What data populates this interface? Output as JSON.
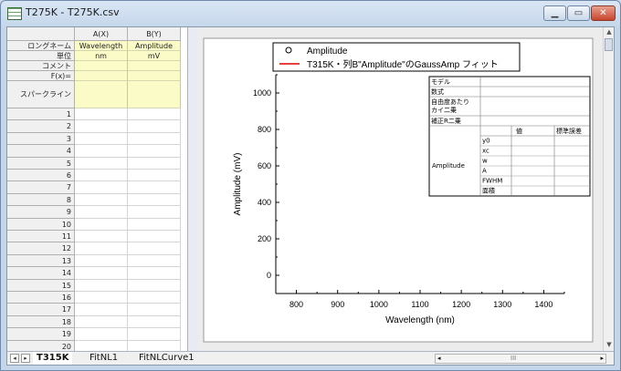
{
  "window": {
    "title": "T275K - T275K.csv",
    "min_label": "▁",
    "max_label": "▭",
    "close_label": "✕"
  },
  "sheet": {
    "columns": [
      "A(X)",
      "B(Y)"
    ],
    "label_rows": [
      {
        "label": "ロングネーム",
        "values": [
          "Wavelength",
          "Amplitude"
        ]
      },
      {
        "label": "単位",
        "values": [
          "nm",
          "mV"
        ]
      },
      {
        "label": "コメント",
        "values": [
          "",
          ""
        ]
      },
      {
        "label": "F(x)=",
        "values": [
          "",
          ""
        ]
      },
      {
        "label": "スパークライン",
        "values": [
          "",
          ""
        ]
      }
    ],
    "rows": [
      "1",
      "2",
      "3",
      "4",
      "5",
      "6",
      "7",
      "8",
      "9",
      "10",
      "11",
      "12",
      "13",
      "14",
      "15",
      "16",
      "17",
      "18",
      "19",
      "20"
    ]
  },
  "tabs": [
    {
      "label": "T315K",
      "active": true
    },
    {
      "label": "FitNL1",
      "active": false
    },
    {
      "label": "FitNLCurve1",
      "active": false
    }
  ],
  "legend": {
    "items": [
      {
        "symbol": "circle",
        "label": "Amplitude"
      },
      {
        "symbol": "red-line",
        "label": "T315K・列B\"Amplitude\"のGaussAmp フィット"
      }
    ]
  },
  "fit_table": {
    "rows_top": [
      "モデル",
      "数式",
      "自由度あたりカイ二乗",
      "補正R二乗"
    ],
    "col_value": "値",
    "col_error": "標準誤差",
    "param_group": "Amplitude",
    "params": [
      "y0",
      "xc",
      "w",
      "A",
      "FWHM",
      "面積"
    ]
  },
  "chart_data": {
    "type": "scatter",
    "series": [],
    "xlabel": "Wavelength (nm)",
    "ylabel": "Amplitude (mV)",
    "xlim": [
      750,
      1450
    ],
    "ylim": [
      -100,
      1100
    ],
    "xticks": [
      "800",
      "900",
      "1000",
      "1100",
      "1200",
      "1300",
      "1400"
    ],
    "yticks": [
      "0",
      "200",
      "400",
      "600",
      "800",
      "1000"
    ],
    "grid": false,
    "fit_color": "#e00000"
  },
  "bottom": {
    "nav_left": "◂",
    "nav_right": "▸",
    "scroll_left": "◂",
    "scroll_right": "▸",
    "grip": "III"
  }
}
